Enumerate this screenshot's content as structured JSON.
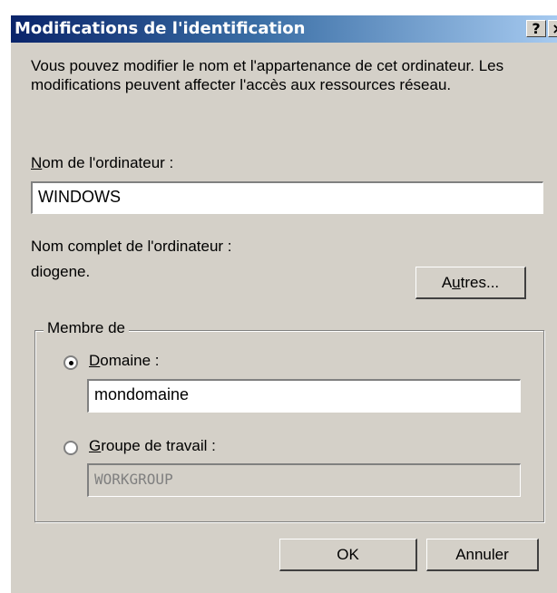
{
  "window": {
    "title": "Modifications de l'identification",
    "help_label": "?",
    "close_label": "×"
  },
  "description": "Vous pouvez modifier le nom et l'appartenance de cet ordinateur. Les modifications peuvent affecter l'accès aux ressources réseau.",
  "computer_name": {
    "label_accel": "N",
    "label_rest": "om de l'ordinateur :",
    "value": "WINDOWS"
  },
  "full_name": {
    "label": "Nom complet de l'ordinateur :",
    "value": "diogene."
  },
  "more_button": {
    "label_pre": "A",
    "label_accel": "u",
    "label_rest": "tres..."
  },
  "member_of": {
    "legend": "Membre de",
    "domain": {
      "label_accel": "D",
      "label_rest": "omaine :",
      "selected": true,
      "value": "mondomaine"
    },
    "workgroup": {
      "label_accel": "G",
      "label_rest": "roupe de travail :",
      "selected": false,
      "value": "WORKGROUP"
    }
  },
  "buttons": {
    "ok": "OK",
    "cancel": "Annuler"
  }
}
